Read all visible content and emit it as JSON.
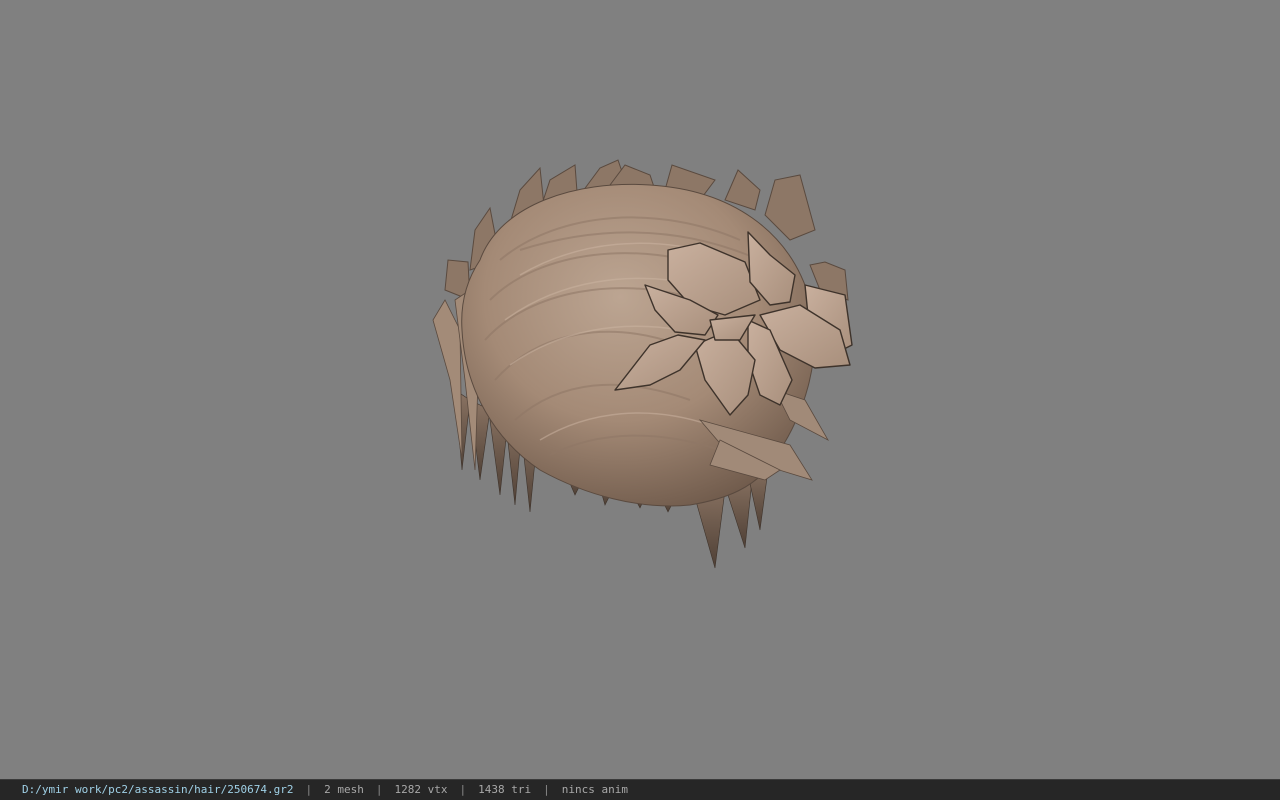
{
  "viewer": {
    "background_color": "#808080",
    "model": {
      "type": "hair mesh",
      "base_color": "#b39a86",
      "shadow_color": "#6e5a4a",
      "leaf_color": "#c2a896",
      "leaf_outline": "#3e332b"
    }
  },
  "status": {
    "file_path": "D:/ymir work/pc2/assassin/hair/250674.gr2",
    "separator": "|",
    "mesh_count": "2 mesh",
    "vertex_count": "1282 vtx",
    "triangle_count": "1438 tri",
    "anim_state": "nincs anim"
  }
}
